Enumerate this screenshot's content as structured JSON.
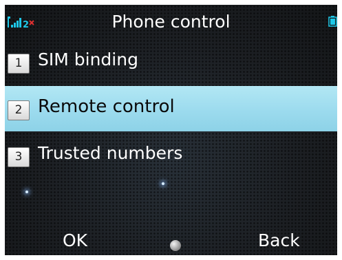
{
  "status_bar": {
    "title": "Phone control",
    "signal_icon": "signal-bars-icon",
    "sim_number": "2",
    "battery_icon": "battery-icon"
  },
  "menu": {
    "items": [
      {
        "number": "1",
        "label": "SIM binding",
        "selected": false
      },
      {
        "number": "2",
        "label": "Remote control",
        "selected": true
      },
      {
        "number": "3",
        "label": "Trusted numbers",
        "selected": false
      }
    ]
  },
  "softkeys": {
    "left": "OK",
    "center_icon": "select-dot-icon",
    "right": "Back"
  },
  "colors": {
    "background": "#1c1f22",
    "selection": "#9cdbee",
    "text": "#ffffff",
    "selected_text": "#0a0a0a",
    "signal": "#1ec8e8",
    "no_sim_mark": "#e03030"
  }
}
